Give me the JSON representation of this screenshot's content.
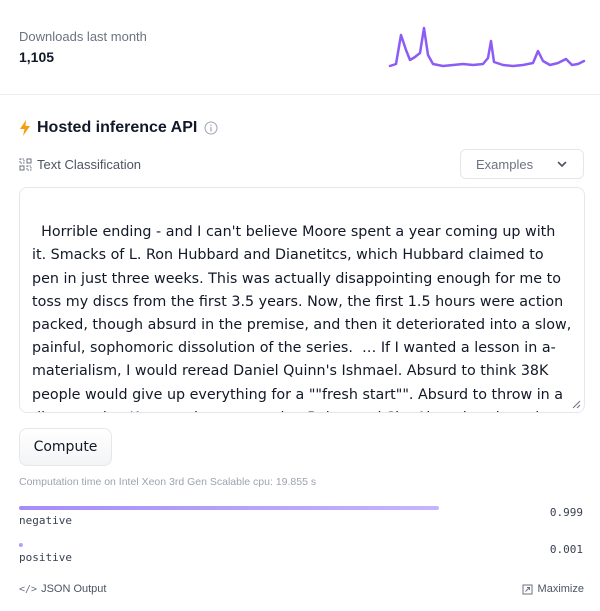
{
  "downloads": {
    "label": "Downloads last month",
    "value": "1,105",
    "sparkline_color": "#8b5cf6"
  },
  "api": {
    "title": "Hosted inference API",
    "bolt_color": "#f59e0b",
    "task": "Text Classification",
    "examples_label": "Examples"
  },
  "input": {
    "text": "Horrible ending - and I can't believe Moore spent a year coming up with it. Smacks of L. Ron Hubbard and Dianetitcs, which Hubbard claimed to pen in just three weeks. This was actually disappointing enough for me to toss my discs from the first 3.5 years. Now, the first 1.5 hours were action packed, though absurd in the premise, and then it deteriorated into a slow, painful, sophomoric dissolution of the series.  … If I wanted a lesson in a-materialism, I would reread Daniel Quinn's Ishmael. Absurd to think 38K people would give up everything for a \"\"fresh start\"\". Absurd to throw in a disappearing Kara, and a reappearing Baltar and Six. Absurd to throw in the Mitochondrial Eve. Just absurd.\""
  },
  "compute": {
    "button_label": "Compute",
    "time_text": "Computation time on Intel Xeon 3rd Gen Scalable cpu: 19.855 s"
  },
  "results": [
    {
      "label": "negative",
      "score_text": "0.999",
      "score": 0.999
    },
    {
      "label": "positive",
      "score_text": "0.001",
      "score": 0.001
    }
  ],
  "footer": {
    "json_label": "JSON Output",
    "maximize_label": "Maximize"
  }
}
